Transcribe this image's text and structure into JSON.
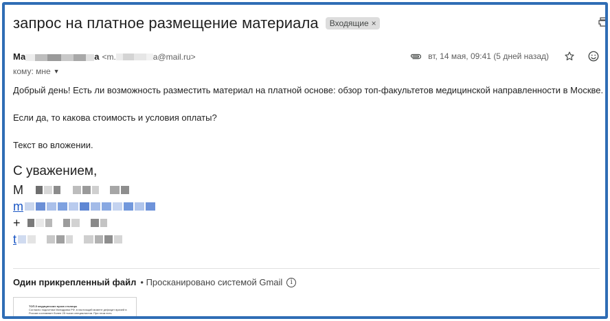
{
  "email": {
    "subject": "запрос на платное размещение материала",
    "label": "Входящие",
    "label_close": "×",
    "sender": {
      "name_start": "Ма",
      "name_end": "а",
      "email_start": "<m.",
      "email_end": "a@mail.ru>"
    },
    "recipient": {
      "text": "кому: мне",
      "caret": "▼"
    },
    "date": "вт, 14 мая, 09:41 (5 дней назад)",
    "icons": [
      "paperclip-icon",
      "star-icon",
      "emoji-icon"
    ]
  },
  "body": {
    "p1": "Добрый день! Есть ли возможность разместить материал на платной основе: обзор топ-факультетов медицинской направленности в Москве.",
    "p2": "Если да, то какова стоимость и условия оплаты?",
    "p3": "Текст во вложении."
  },
  "signature": {
    "regards": "С уважением,",
    "name_initial": "М",
    "email_initial": "m",
    "phone_initial": "+",
    "link_initial": "t"
  },
  "attachments": {
    "title": "Один прикрепленный файл",
    "scan_text": "• Просканировано системой Gmail",
    "info_glyph": "i",
    "preview": {
      "line1": "ТОП-5 медицинских вузов столицы",
      "line2": "Согласно подсчетам Минздрава РФ, в настоящий момент дефицит врачей в",
      "line3": "России составляет более 25 тысяч специалистов. При этом есть"
    }
  },
  "colors": {
    "frame": "#2f6db5",
    "link": "#1a56c4",
    "chip": "#dddddd"
  }
}
